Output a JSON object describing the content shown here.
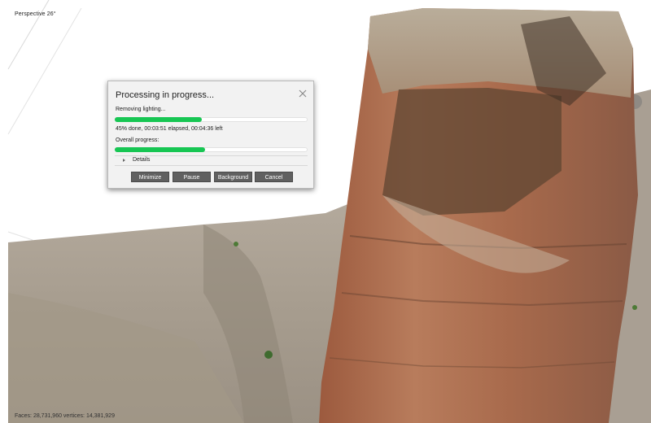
{
  "viewport": {
    "projection_label": "Perspective 26°",
    "status_text": "Faces: 28,731,960 vertices: 14,381,929"
  },
  "dialog": {
    "title": "Processing in progress...",
    "current_step": "Removing lighting...",
    "step_progress": 0.45,
    "status": "45% done, 00:03:51 elapsed, 00:04:36 left",
    "overall_label": "Overall progress:",
    "overall_progress": 0.47,
    "details_label": "Details",
    "buttons": {
      "minimize": "Minimize",
      "pause": "Pause",
      "background": "Background",
      "cancel": "Cancel"
    }
  },
  "icons": {
    "close": "close-icon",
    "details_toggle": "triangle-right-icon"
  },
  "colors": {
    "progress_fill": "#17c653",
    "button_bg": "#606060",
    "dialog_bg": "#f2f2f2"
  }
}
